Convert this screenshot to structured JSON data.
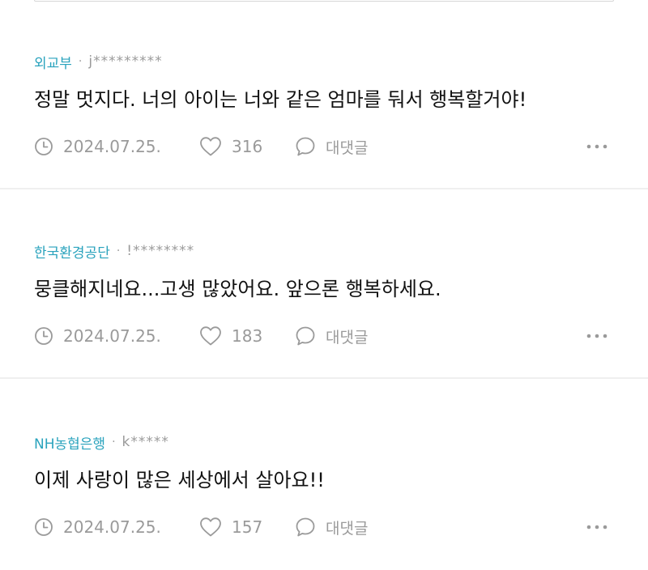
{
  "comments": [
    {
      "author": "외교부",
      "separator": "·",
      "user_id": "j*********",
      "text": "정말 멋지다. 너의 아이는 너와 같은 엄마를 둬서 행복할거야!",
      "date": "2024.07.25.",
      "likes": "316",
      "reply_label": "대댓글"
    },
    {
      "author": "한국환경공단",
      "separator": "·",
      "user_id": "!********",
      "text": "뭉클해지네요...고생 많았어요. 앞으론 행복하세요.",
      "date": "2024.07.25.",
      "likes": "183",
      "reply_label": "대댓글"
    },
    {
      "author": "NH농협은행",
      "separator": "·",
      "user_id": "k*****",
      "text": "이제 사랑이 많은 세상에서 살아요!!",
      "date": "2024.07.25.",
      "likes": "157",
      "reply_label": "대댓글"
    }
  ],
  "icons": {
    "date": "clock-icon",
    "like": "heart-icon",
    "reply": "speech-bubble-icon",
    "more": "more-dots-icon"
  },
  "colors": {
    "author": "#2aa3bd",
    "muted": "#9a9a9a",
    "divider": "#efefef"
  }
}
